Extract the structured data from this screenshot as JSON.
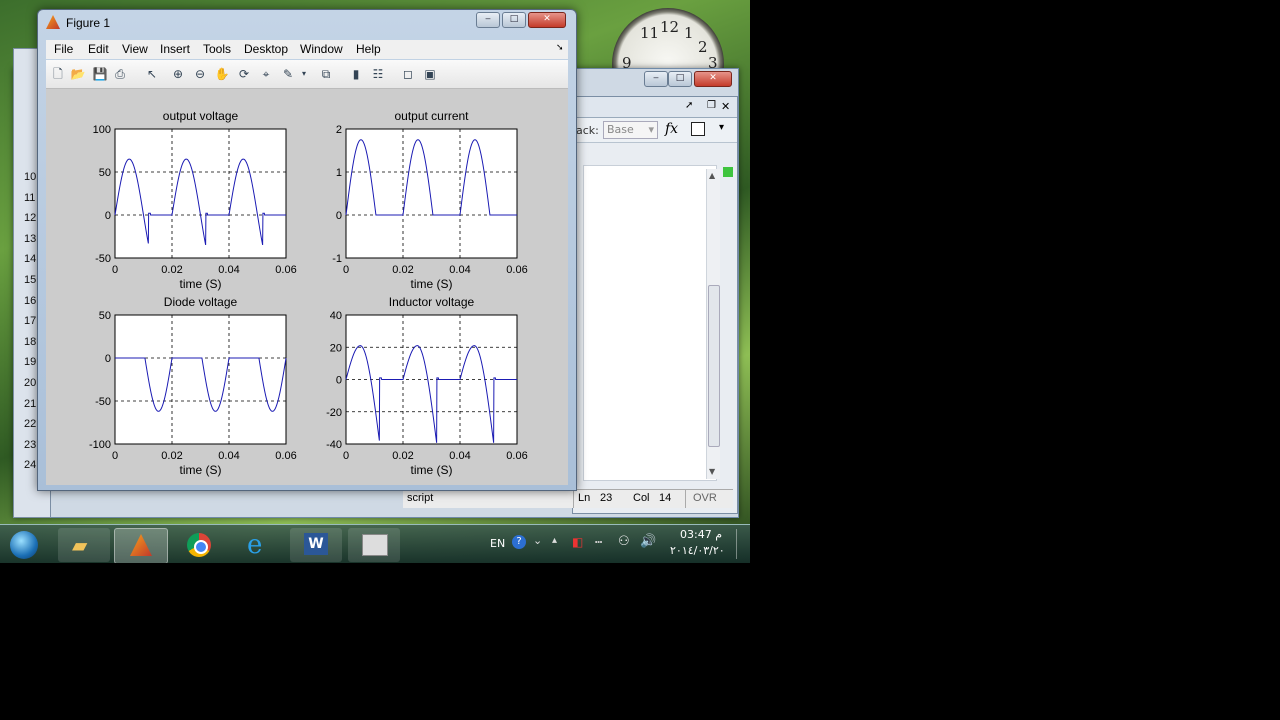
{
  "figure": {
    "title": "Figure 1",
    "menu": [
      "File",
      "Edit",
      "View",
      "Insert",
      "Tools",
      "Desktop",
      "Window",
      "Help"
    ],
    "toolbar_icons": [
      "new-figure-icon",
      "open-file-icon",
      "save-icon",
      "print-icon",
      "pointer-icon",
      "zoom-in-icon",
      "zoom-out-icon",
      "pan-icon",
      "rotate-icon",
      "data-cursor-icon",
      "brush-icon",
      "link-icon",
      "colorbar-icon",
      "legend-icon",
      "hide-plot-tools-icon",
      "show-plot-tools-icon"
    ]
  },
  "editor": {
    "stack_label": "ack:",
    "stack_value": "Base",
    "fx_symbol": "fx",
    "line_numbers": [
      "10",
      "11",
      "12",
      "13",
      "14",
      "15",
      "16",
      "17",
      "18",
      "19",
      "20",
      "21",
      "22",
      "23",
      "24"
    ]
  },
  "statusbar": {
    "script": "script",
    "ln_label": "Ln",
    "ln_value": "23",
    "col_label": "Col",
    "col_value": "14",
    "ovr": "OVR"
  },
  "taskbar": {
    "lang": "EN",
    "time": "03:47 م",
    "date": "٢٠١٤/٠٣/٢٠",
    "apps": [
      "start-orb-icon",
      "folder-icon",
      "matlab-icon",
      "chrome-icon",
      "ie-icon",
      "word-icon",
      "video-icon"
    ]
  },
  "clock": {
    "numerals": [
      "12",
      "11",
      "1",
      "2",
      "9",
      "3"
    ]
  },
  "chart_data": [
    {
      "type": "line",
      "title": "output voltage",
      "xlabel": "time (S)",
      "ylabel": "",
      "xlim": [
        0,
        0.06
      ],
      "ylim": [
        -50,
        100
      ],
      "xticks": [
        "0",
        "0.02",
        "0.04",
        "0.06"
      ],
      "yticks": [
        "100",
        "50",
        "0",
        "-50"
      ],
      "grid": true,
      "waveform": "output_voltage",
      "x_period": 0.02,
      "peak": 65,
      "trough": -28
    },
    {
      "type": "line",
      "title": "output current",
      "xlabel": "time (S)",
      "ylabel": "",
      "xlim": [
        0,
        0.06
      ],
      "ylim": [
        -1,
        2
      ],
      "xticks": [
        "0",
        "0.02",
        "0.04",
        "0.06"
      ],
      "yticks": [
        "2",
        "1",
        "0",
        "-1"
      ],
      "grid": true,
      "waveform": "output_current",
      "x_period": 0.02,
      "peak": 1.75,
      "trough": 0
    },
    {
      "type": "line",
      "title": "Diode voltage",
      "xlabel": "time (S)",
      "ylabel": "",
      "xlim": [
        0,
        0.06
      ],
      "ylim": [
        -100,
        50
      ],
      "xticks": [
        "0",
        "0.02",
        "0.04",
        "0.06"
      ],
      "yticks": [
        "50",
        "0",
        "-50",
        "-100"
      ],
      "grid": true,
      "waveform": "diode_voltage",
      "x_period": 0.02,
      "peak": 0,
      "trough": -62
    },
    {
      "type": "line",
      "title": "Inductor voltage",
      "xlabel": "time (S)",
      "ylabel": "",
      "xlim": [
        0,
        0.06
      ],
      "ylim": [
        -40,
        40
      ],
      "xticks": [
        "0",
        "0.02",
        "0.04",
        "0.06"
      ],
      "yticks": [
        "40",
        "20",
        "0",
        "-20",
        "-40"
      ],
      "grid": true,
      "waveform": "inductor_voltage",
      "x_period": 0.02,
      "peak": 21,
      "trough": -28
    }
  ]
}
